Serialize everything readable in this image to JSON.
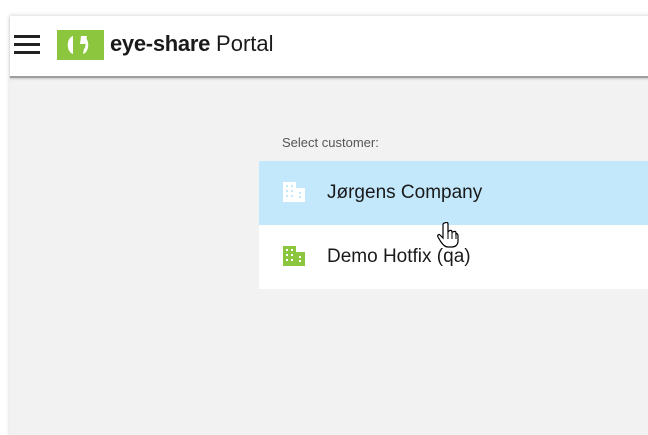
{
  "header": {
    "brand_bold": "eye-share",
    "brand_light": "Portal",
    "menu_icon": "hamburger-menu-icon",
    "logo_icon": "eye-share-logo"
  },
  "customer_select": {
    "label": "Select customer:",
    "items": [
      {
        "name": "Jørgens Company",
        "icon": "building-icon",
        "selected": true
      },
      {
        "name": "Demo Hotfix (qa)",
        "icon": "building-icon",
        "selected": false
      }
    ]
  },
  "colors": {
    "brand_green": "#8cc63f",
    "selected_row": "#c3e8fb",
    "background": "#f2f2f2"
  }
}
